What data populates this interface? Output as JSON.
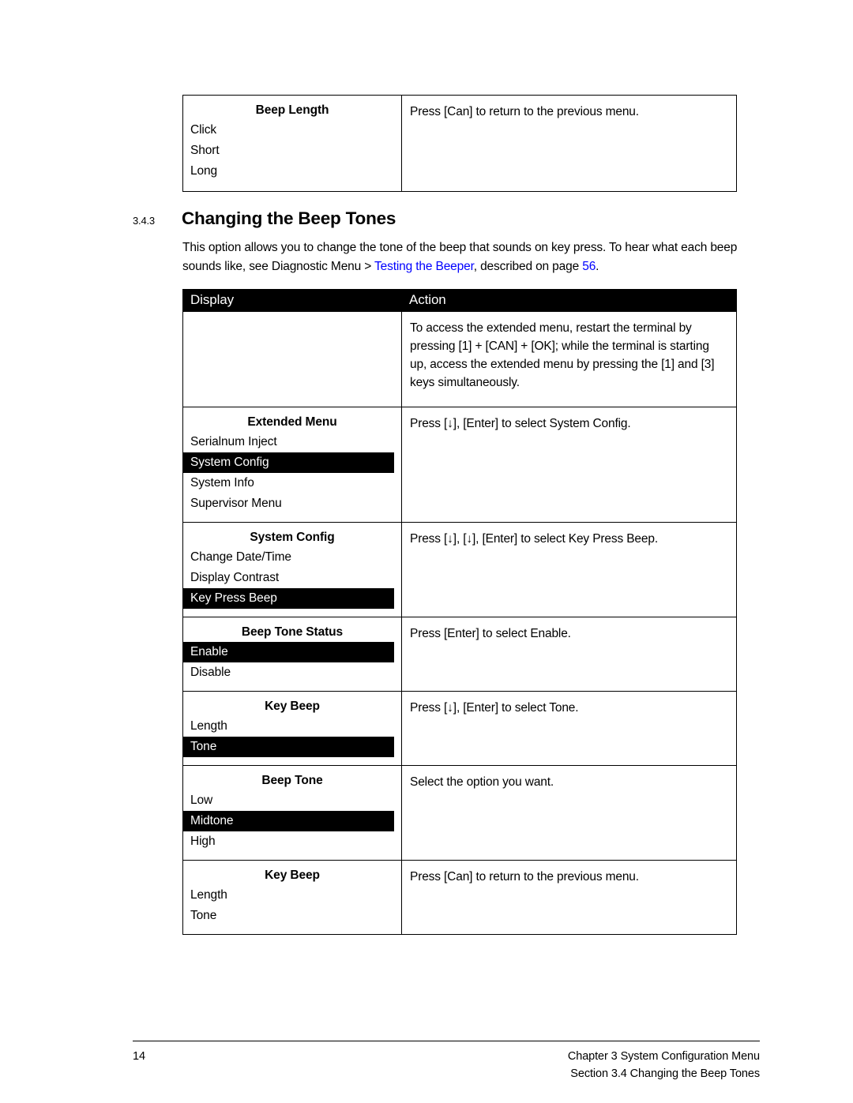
{
  "top_table": {
    "display": {
      "title": "Beep Length",
      "items": [
        {
          "label": "Click",
          "selected": false
        },
        {
          "label": "Short",
          "selected": false
        },
        {
          "label": "Long",
          "selected": false
        }
      ]
    },
    "action": "Press [Can] to return to the previous menu."
  },
  "heading": {
    "number": "3.4.3",
    "title": "Changing the Beep Tones"
  },
  "intro": {
    "part1": "This option allows you to change the tone of the beep that sounds on key press. To hear what each beep sounds like, see Diagnostic Menu > ",
    "link": "Testing the Beeper",
    "part2": ", described on page ",
    "page_link": "56",
    "part3": "."
  },
  "main_table": {
    "headers": {
      "display": "Display",
      "action": "Action"
    },
    "rows": [
      {
        "display": {
          "title": "",
          "items": []
        },
        "action": "To access the extended menu, restart the terminal by pressing [1] + [CAN] + [OK]; while the terminal is starting up, access the extended menu by pressing the [1] and [3] keys simultaneously."
      },
      {
        "display": {
          "title": "Extended Menu",
          "items": [
            {
              "label": "Serialnum Inject",
              "selected": false
            },
            {
              "label": "System Config",
              "selected": true
            },
            {
              "label": "System Info",
              "selected": false
            },
            {
              "label": "Supervisor Menu",
              "selected": false
            }
          ]
        },
        "action": "Press [↓], [Enter] to select System Config."
      },
      {
        "display": {
          "title": "System Config",
          "items": [
            {
              "label": "Change Date/Time",
              "selected": false
            },
            {
              "label": "Display Contrast",
              "selected": false
            },
            {
              "label": "Key Press Beep",
              "selected": true
            }
          ]
        },
        "action": "Press [↓], [↓], [Enter] to select Key Press Beep."
      },
      {
        "display": {
          "title": "Beep Tone Status",
          "items": [
            {
              "label": "Enable",
              "selected": true
            },
            {
              "label": "Disable",
              "selected": false
            }
          ]
        },
        "action": "Press [Enter] to select Enable."
      },
      {
        "display": {
          "title": "Key Beep",
          "items": [
            {
              "label": "Length",
              "selected": false
            },
            {
              "label": "Tone",
              "selected": true
            }
          ]
        },
        "action": "Press [↓], [Enter] to select Tone."
      },
      {
        "display": {
          "title": "Beep Tone",
          "items": [
            {
              "label": "Low",
              "selected": false
            },
            {
              "label": "Midtone",
              "selected": true
            },
            {
              "label": "High",
              "selected": false
            }
          ]
        },
        "action": "Select the option you want."
      },
      {
        "display": {
          "title": "Key Beep",
          "items": [
            {
              "label": "Length",
              "selected": false
            },
            {
              "label": "Tone",
              "selected": false
            }
          ]
        },
        "action": "Press [Can] to return to the previous menu."
      }
    ]
  },
  "footer": {
    "page_number": "14",
    "chapter": "Chapter 3 System Configuration Menu",
    "section": "Section 3.4 Changing the Beep Tones"
  },
  "colors": {
    "link": "#0000ff",
    "header_bg": "#000000",
    "highlight_bg": "#000000",
    "text": "#000000"
  }
}
